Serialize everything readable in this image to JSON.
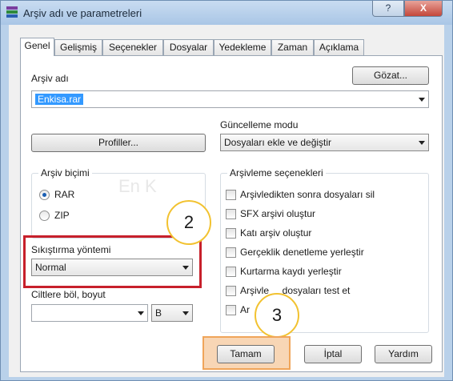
{
  "window": {
    "title": "Arşiv adı ve parametreleri",
    "help_label": "?",
    "close_label": "X"
  },
  "tabs": [
    {
      "label": "Genel",
      "active": true
    },
    {
      "label": "Gelişmiş"
    },
    {
      "label": "Seçenekler"
    },
    {
      "label": "Dosyalar"
    },
    {
      "label": "Yedekleme"
    },
    {
      "label": "Zaman"
    },
    {
      "label": "Açıklama"
    }
  ],
  "archive_name": {
    "label": "Arşiv adı",
    "value": "Enkisa.rar",
    "browse_label": "Gözat..."
  },
  "profiles_label": "Profiller...",
  "update_mode": {
    "label": "Güncelleme modu",
    "value": "Dosyaları ekle ve değiştir"
  },
  "archive_format": {
    "label": "Arşiv biçimi",
    "options": [
      "RAR",
      "ZIP"
    ],
    "selected": "RAR"
  },
  "compression": {
    "label": "Sıkıştırma yöntemi",
    "value": "Normal"
  },
  "split": {
    "label": "Ciltlere böl, boyut",
    "value": "",
    "unit": "B"
  },
  "archive_options": {
    "label": "Arşivleme seçenekleri",
    "items": [
      {
        "label": "Arşivledikten sonra dosyaları sil"
      },
      {
        "label": "SFX arşivi oluştur"
      },
      {
        "label": "Katı arşiv oluştur"
      },
      {
        "label": "Gerçeklik denetleme yerleştir"
      },
      {
        "label": "Kurtarma kaydı yerleştir"
      },
      {
        "label": "Arşivle     dosyaları test et"
      },
      {
        "label": "Ar"
      }
    ]
  },
  "buttons": {
    "ok": "Tamam",
    "cancel": "İptal",
    "help": "Yardım"
  },
  "callouts": [
    "2",
    "3"
  ],
  "watermark": "En K",
  "colors": {
    "highlight_red": "#c7202b",
    "highlight_orange": "#f0a55a",
    "callout_border": "#f2c230",
    "selection": "#3399ff"
  }
}
